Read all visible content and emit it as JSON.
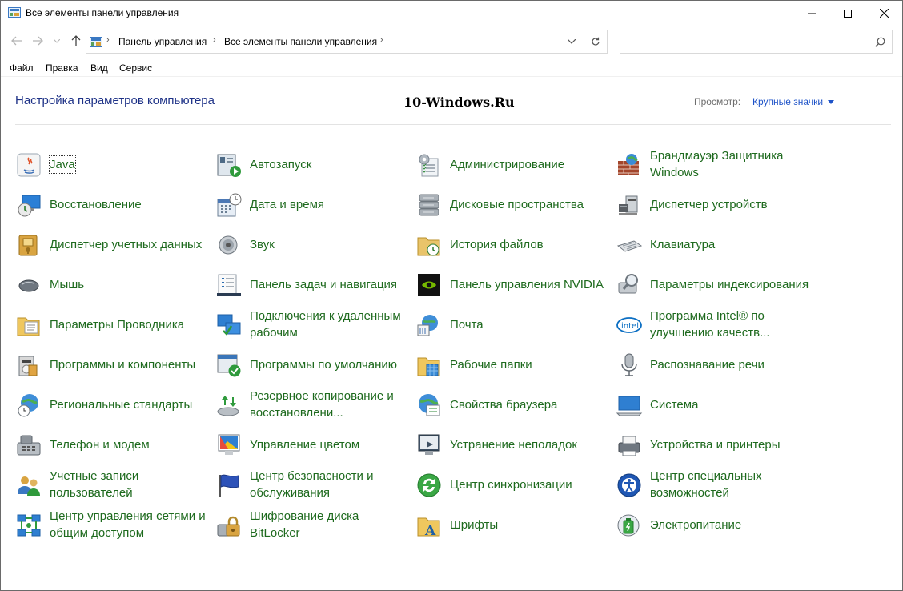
{
  "window": {
    "title": "Все элементы панели управления"
  },
  "address": {
    "crumbs": [
      "Панель управления",
      "Все элементы панели управления"
    ],
    "search_placeholder": ""
  },
  "menu": [
    "Файл",
    "Правка",
    "Вид",
    "Сервис"
  ],
  "header": {
    "heading": "Настройка параметров компьютера",
    "watermark": "10-Windows.Ru",
    "view_label": "Просмотр:",
    "view_value": "Крупные значки"
  },
  "colors": {
    "link_green": "#1e6a1e",
    "heading_blue": "#1e3287",
    "accent_blue": "#1e53c8"
  },
  "items": [
    {
      "label": "Java",
      "icon": "java-icon"
    },
    {
      "label": "Автозапуск",
      "icon": "autoplay-icon"
    },
    {
      "label": "Администрирование",
      "icon": "admin-tools-icon"
    },
    {
      "label": "Брандмауэр Защитника Windows",
      "icon": "firewall-icon"
    },
    {
      "label": "Восстановление",
      "icon": "recovery-icon"
    },
    {
      "label": "Дата и время",
      "icon": "date-time-icon"
    },
    {
      "label": "Дисковые пространства",
      "icon": "storage-spaces-icon"
    },
    {
      "label": "Диспетчер устройств",
      "icon": "device-manager-icon"
    },
    {
      "label": "Диспетчер учетных данных",
      "icon": "credential-manager-icon"
    },
    {
      "label": "Звук",
      "icon": "sound-icon"
    },
    {
      "label": "История файлов",
      "icon": "file-history-icon"
    },
    {
      "label": "Клавиатура",
      "icon": "keyboard-icon"
    },
    {
      "label": "Мышь",
      "icon": "mouse-icon"
    },
    {
      "label": "Панель задач и навигация",
      "icon": "taskbar-icon"
    },
    {
      "label": "Панель управления NVIDIA",
      "icon": "nvidia-icon"
    },
    {
      "label": "Параметры индексирования",
      "icon": "indexing-icon"
    },
    {
      "label": "Параметры Проводника",
      "icon": "explorer-options-icon"
    },
    {
      "label": "Подключения к удаленным рабочим",
      "icon": "remote-desktop-icon"
    },
    {
      "label": "Почта",
      "icon": "mail-icon"
    },
    {
      "label": "Программа Intel® по улучшению качеств...",
      "icon": "intel-icon"
    },
    {
      "label": "Программы и компоненты",
      "icon": "programs-icon"
    },
    {
      "label": "Программы по умолчанию",
      "icon": "default-programs-icon"
    },
    {
      "label": "Рабочие папки",
      "icon": "work-folders-icon"
    },
    {
      "label": "Распознавание речи",
      "icon": "microphone-icon"
    },
    {
      "label": "Региональные стандарты",
      "icon": "region-icon"
    },
    {
      "label": "Резервное копирование и восстановлени...",
      "icon": "backup-icon"
    },
    {
      "label": "Свойства браузера",
      "icon": "internet-options-icon"
    },
    {
      "label": "Система",
      "icon": "system-icon"
    },
    {
      "label": "Телефон и модем",
      "icon": "phone-modem-icon"
    },
    {
      "label": "Управление цветом",
      "icon": "color-management-icon"
    },
    {
      "label": "Устранение неполадок",
      "icon": "troubleshooting-icon"
    },
    {
      "label": "Устройства и принтеры",
      "icon": "devices-printers-icon"
    },
    {
      "label": "Учетные записи пользователей",
      "icon": "user-accounts-icon"
    },
    {
      "label": "Центр безопасности и обслуживания",
      "icon": "security-flag-icon"
    },
    {
      "label": "Центр синхронизации",
      "icon": "sync-center-icon"
    },
    {
      "label": "Центр специальных возможностей",
      "icon": "accessibility-icon"
    },
    {
      "label": "Центр управления сетями и общим доступом",
      "icon": "network-center-icon"
    },
    {
      "label": "Шифрование диска BitLocker",
      "icon": "bitlocker-icon"
    },
    {
      "label": "Шрифты",
      "icon": "fonts-icon"
    },
    {
      "label": "Электропитание",
      "icon": "power-options-icon"
    }
  ]
}
